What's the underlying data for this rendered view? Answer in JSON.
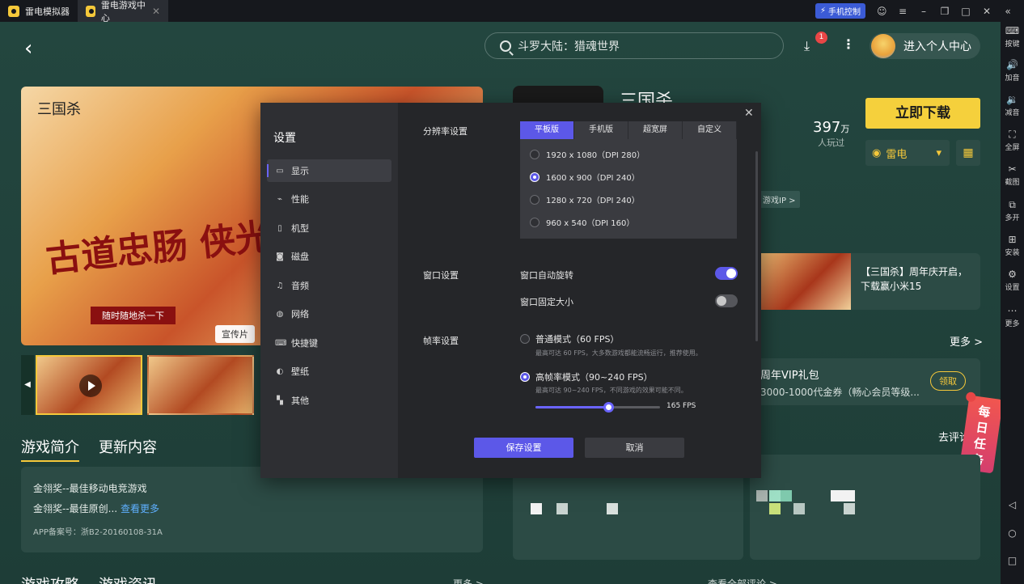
{
  "titlebar": {
    "tabs": [
      {
        "label": "雷电模拟器",
        "icon": "ldplayer-logo-icon"
      },
      {
        "label": "雷电游戏中心",
        "icon": "game-center-logo-icon"
      }
    ],
    "phone_control": "手机控制"
  },
  "rightbar": [
    {
      "label": "按键",
      "icon": "keyboard-icon"
    },
    {
      "label": "加音",
      "icon": "volume-up-icon"
    },
    {
      "label": "减音",
      "icon": "volume-down-icon"
    },
    {
      "label": "全屏",
      "icon": "fullscreen-icon"
    },
    {
      "label": "截图",
      "icon": "scissors-icon"
    },
    {
      "label": "多开",
      "icon": "multi-instance-icon"
    },
    {
      "label": "安装",
      "icon": "install-icon"
    },
    {
      "label": "设置",
      "icon": "gear-icon"
    },
    {
      "label": "更多",
      "icon": "more-icon"
    }
  ],
  "header": {
    "search_text": "斗罗大陆：猎魂世界",
    "download_badge": "1",
    "profile_label": "进入个人中心"
  },
  "game": {
    "hero_logo": "三国杀",
    "hero_slogan": "古道忠肠 侠光万丈",
    "hero_tag": "随时随地杀一下",
    "promo_label": "宣传片",
    "title": "三国杀",
    "players": "397",
    "players_unit": "万",
    "players_label": "人玩过",
    "download_button": "立即下载",
    "ld_label": "雷电",
    "ip_chip": "游戏IP >",
    "news_text": "【三国杀】周年庆开启，下载赢小米15",
    "more_label": "更多 >",
    "vip_title": "周年VIP礼包",
    "vip_desc": "3000-1000代金券（畅心会员等级...",
    "vip_button": "领取",
    "comment_label": "去评论",
    "task_label": "每日任务"
  },
  "intro": {
    "tab_intro": "游戏简介",
    "tab_update": "更新内容",
    "line1": "金翎奖--最佳移动电竞游戏",
    "line2": "金翎奖--最佳原创...",
    "more_link": "查看更多",
    "icp": "APP备案号：浙B2-20160108-31A"
  },
  "bottom": {
    "tab1": "游戏攻略",
    "tab2": "游戏资讯",
    "more1": "更多 >",
    "more2": "查看全部评论 >"
  },
  "settings": {
    "title": "设置",
    "nav": [
      {
        "label": "显示",
        "icon": "monitor-icon",
        "active": true
      },
      {
        "label": "性能",
        "icon": "performance-icon",
        "active": false
      },
      {
        "label": "机型",
        "icon": "device-icon",
        "active": false
      },
      {
        "label": "磁盘",
        "icon": "disk-icon",
        "active": false
      },
      {
        "label": "音频",
        "icon": "audio-icon",
        "active": false
      },
      {
        "label": "网络",
        "icon": "globe-icon",
        "active": false
      },
      {
        "label": "快捷键",
        "icon": "keyboard-icon",
        "active": false
      },
      {
        "label": "壁纸",
        "icon": "palette-icon",
        "active": false
      },
      {
        "label": "其他",
        "icon": "grid-icon",
        "active": false
      }
    ],
    "resolution_label": "分辨率设置",
    "res_tabs": [
      "平板版",
      "手机版",
      "超宽屏",
      "自定义"
    ],
    "res_tab_active": "平板版",
    "resolutions": [
      {
        "label": "1920 x 1080（DPI 280）",
        "selected": false
      },
      {
        "label": "1600 x 900（DPI 240）",
        "selected": true
      },
      {
        "label": "1280 x 720（DPI 240）",
        "selected": false
      },
      {
        "label": "960 x 540（DPI 160）",
        "selected": false
      }
    ],
    "window_label": "窗口设置",
    "window_rotate": "窗口自动旋转",
    "window_rotate_on": true,
    "window_fixed": "窗口固定大小",
    "window_fixed_on": false,
    "fps_label": "帧率设置",
    "fps_normal": "普通模式（60 FPS）",
    "fps_normal_desc": "最高可达 60 FPS，大多数游戏都能流畅运行，推荐使用。",
    "fps_high": "高帧率模式（90~240 FPS）",
    "fps_high_desc": "最高可达 90~240 FPS，不同游戏的效果可能不同。",
    "fps_high_selected": true,
    "fps_value": 165,
    "fps_min": 90,
    "fps_max": 240,
    "fps_value_label": "165 FPS",
    "save_button": "保存设置",
    "cancel_button": "取消"
  }
}
